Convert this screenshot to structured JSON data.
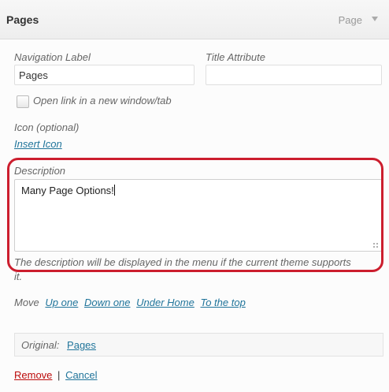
{
  "header": {
    "title": "Pages",
    "type": "Page"
  },
  "fields": {
    "nav_label": {
      "label": "Navigation Label",
      "value": "Pages"
    },
    "title_attr": {
      "label": "Title Attribute",
      "value": ""
    },
    "new_window": {
      "label": "Open link in a new window/tab",
      "checked": false
    },
    "icon": {
      "label": "Icon (optional)",
      "link": "Insert Icon"
    },
    "description": {
      "label": "Description",
      "value": "Many Page Options!",
      "note": "The description will be displayed in the menu if the current theme supports it."
    }
  },
  "move": {
    "label": "Move",
    "up": "Up one",
    "down": "Down one",
    "under": "Under Home",
    "top": "To the top"
  },
  "original": {
    "label": "Original:",
    "link": "Pages"
  },
  "actions": {
    "remove": "Remove",
    "separator": "|",
    "cancel": "Cancel"
  },
  "colors": {
    "highlight": "#cc1e2e",
    "link": "#21759b",
    "remove": "#bc0b0b"
  }
}
